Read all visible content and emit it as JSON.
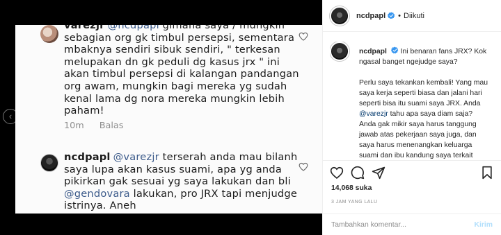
{
  "photo": {
    "comment1": {
      "username": "varezjr",
      "mention": "@ncdpapl",
      "text": "gimana saya / mungkin sebagian org gk timbul persepsi, sementara mbaknya sendiri sibuk sendiri, \" terkesan melupakan dn gk peduli dg kasus jrx \" ini akan timbul persepsi di kalangan pandangan org awam, mungkin bagi mereka yg sudah kenal lama dg nora mereka mungkin lebih paham!",
      "time": "10m",
      "reply": "Balas"
    },
    "comment2": {
      "username": "ncdpapl",
      "mention1": "@varezjr",
      "text1": "terserah anda mau bilanh saya lupa akan kasus suami, apa yg anda pikirkan gak sesuai yg saya lakukan dan bli",
      "mention2": "@gendovara",
      "text2": "lakukan, pro JRX tapi menjudge istrinya. Aneh"
    }
  },
  "header": {
    "username": "ncdpapl",
    "separator": "•",
    "follow_status": "Diikuti"
  },
  "caption": {
    "username": "ncdpapl",
    "line1": "Ini benaran fans JRX? Kok ngasal banget ngejudge saya?",
    "para2_a": "Perlu saya tekankan kembali! Yang mau saya kerja seperti biasa dan jalani hari seperti bisa itu suami saya JRX. Anda",
    "para2_mention": "@varezjr",
    "para2_b": "tahu apa saya diam saja? Anda gak mikir saya harus tanggung jawab atas pekerjaan saya juga, dan saya harus menenangkan keluarga suami dan ibu kandung saya terkait kasus suami saya, belum lagi"
  },
  "likes": "14,068 suka",
  "timestamp": "3 JAM YANG LALU",
  "add_comment": {
    "placeholder": "Tambahkan komentar...",
    "send_label": "Kirim"
  },
  "icons": {
    "like": "heart-icon",
    "comment": "comment-icon",
    "share": "share-icon",
    "save": "bookmark-icon",
    "verified": "verified-badge-icon",
    "prev": "chevron-left-icon"
  },
  "colors": {
    "verified": "#3897f0",
    "mention": "#00376b",
    "send_disabled": "#b2dffc"
  }
}
